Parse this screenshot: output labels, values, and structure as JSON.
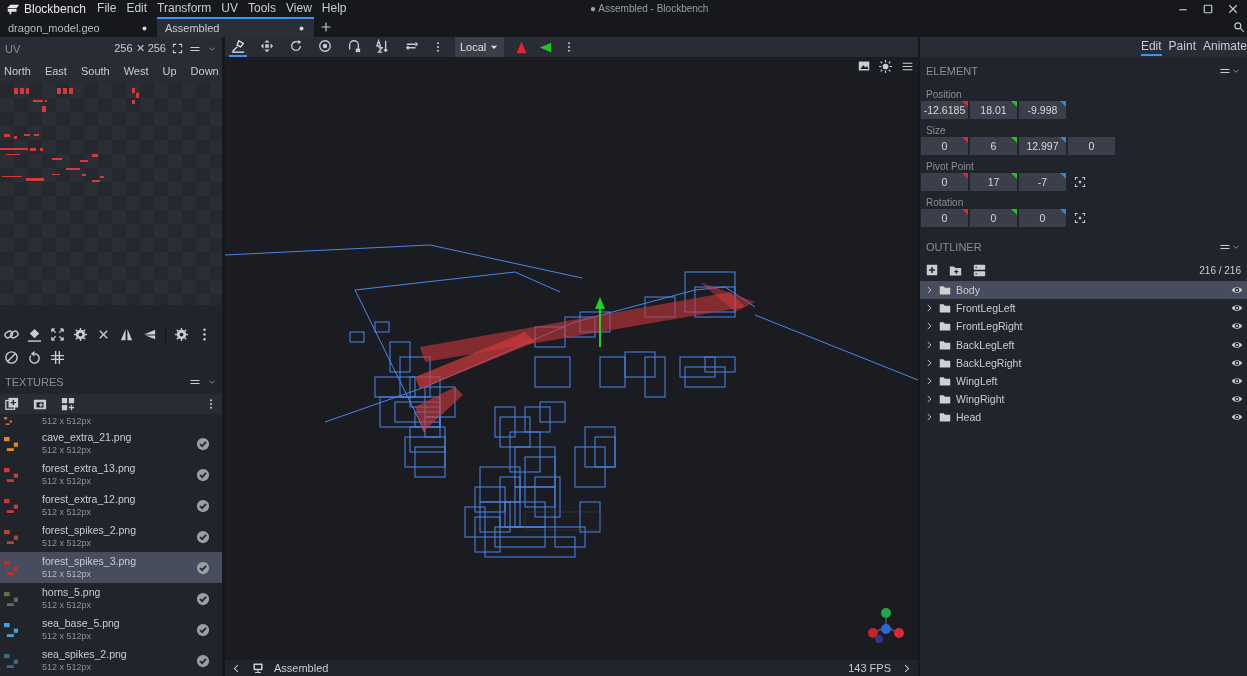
{
  "window": {
    "app_name": "Blockbench",
    "title": "● Assembled - Blockbench"
  },
  "menu": [
    "File",
    "Edit",
    "Transform",
    "UV",
    "Tools",
    "View",
    "Help"
  ],
  "tabs": [
    {
      "label": "dragon_model.geo",
      "selected": false,
      "unsaved": true
    },
    {
      "label": "Assembled",
      "selected": true,
      "unsaved": true
    }
  ],
  "uv_panel": {
    "title": "UV",
    "size": "256 ✕ 256",
    "faces": [
      {
        "label": "North",
        "selected": false
      },
      {
        "label": "East",
        "selected": false
      },
      {
        "label": "South",
        "selected": false
      },
      {
        "label": "West",
        "selected": false
      },
      {
        "label": "Up",
        "selected": false
      },
      {
        "label": "Down",
        "selected": false
      }
    ]
  },
  "textures": {
    "title": "TEXTURES",
    "items": [
      {
        "size": "512 x 512px",
        "selected": false
      },
      {
        "name": "cave_extra_21.png",
        "size": "512 x 512px",
        "selected": false
      },
      {
        "name": "forest_extra_13.png",
        "size": "512 x 512px",
        "selected": false
      },
      {
        "name": "forest_extra_12.png",
        "size": "512 x 512px",
        "selected": false
      },
      {
        "name": "forest_spikes_2.png",
        "size": "512 x 512px",
        "selected": false
      },
      {
        "name": "forest_spikes_3.png",
        "size": "512 x 512px",
        "selected": true
      },
      {
        "name": "horns_5.png",
        "size": "512 x 512px",
        "selected": false
      },
      {
        "name": "sea_base_5.png",
        "size": "512 x 512px",
        "selected": false
      },
      {
        "name": "sea_spikes_2.png",
        "size": "512 x 512px",
        "selected": false
      }
    ]
  },
  "viewport": {
    "tools": [
      {
        "kind": "move",
        "selected": true
      },
      {
        "kind": "resize",
        "selected": false
      },
      {
        "kind": "rotate",
        "selected": false
      },
      {
        "kind": "pivot",
        "selected": false
      },
      {
        "kind": "vertex",
        "selected": false
      },
      {
        "kind": "sort",
        "selected": false
      },
      {
        "kind": "swap",
        "selected": false
      }
    ],
    "space": "Local",
    "status_label": "Assembled",
    "fps": "143 FPS"
  },
  "modes": [
    {
      "label": "Edit",
      "selected": true
    },
    {
      "label": "Paint",
      "selected": false
    },
    {
      "label": "Animate",
      "selected": false
    }
  ],
  "element": {
    "title": "ELEMENT",
    "rows": [
      {
        "label": "Position",
        "values": [
          "-12.6185",
          "18.01",
          "-9.998"
        ],
        "center_button": false
      },
      {
        "label": "Size",
        "values": [
          "0",
          "6",
          "12.997",
          "0"
        ],
        "center_button": false
      },
      {
        "label": "Pivot Point",
        "values": [
          "0",
          "17",
          "-7"
        ],
        "center_button": true
      },
      {
        "label": "Rotation",
        "values": [
          "0",
          "0",
          "0"
        ],
        "center_button": true
      }
    ]
  },
  "outliner": {
    "title": "OUTLINER",
    "count": "216 / 216",
    "items": [
      {
        "name": "Body",
        "selected": true,
        "visible": true
      },
      {
        "name": "FrontLegLeft",
        "selected": false,
        "visible": true
      },
      {
        "name": "FrontLegRight",
        "selected": false,
        "visible": true
      },
      {
        "name": "BackLegLeft",
        "selected": false,
        "visible": true
      },
      {
        "name": "BackLegRight",
        "selected": false,
        "visible": true
      },
      {
        "name": "WingLeft",
        "selected": false,
        "visible": true
      },
      {
        "name": "WingRight",
        "selected": false,
        "visible": true
      },
      {
        "name": "Head",
        "selected": false,
        "visible": true
      }
    ]
  }
}
